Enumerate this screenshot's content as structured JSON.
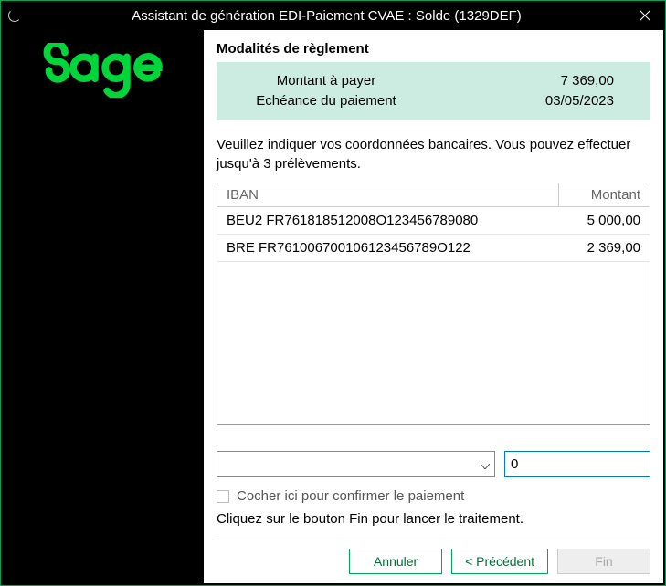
{
  "titlebar": {
    "title": "Assistant de génération EDI-Paiement CVAE : Solde (1329DEF)"
  },
  "section": {
    "title": "Modalités de règlement"
  },
  "summary": {
    "montant_label": "Montant à payer",
    "montant_value": "7 369,00",
    "echeance_label": "Echéance du paiement",
    "echeance_value": "03/05/2023"
  },
  "instructions": "Veuillez indiquer vos coordonnées bancaires. Vous pouvez effectuer jusqu'à 3 prélèvements.",
  "table": {
    "headers": {
      "iban": "IBAN",
      "montant": "Montant"
    },
    "rows": [
      {
        "iban": "BEU2 FR761818512008O123456789080",
        "montant": "5 000,00"
      },
      {
        "iban": "BRE FR761006700106123456789O122",
        "montant": "2 369,00"
      }
    ]
  },
  "form": {
    "combo_value": "",
    "amount_value": "0"
  },
  "checkbox": {
    "label": "Cocher ici pour confirmer le paiement"
  },
  "final_instruction": "Cliquez sur le bouton Fin pour lancer le traitement.",
  "buttons": {
    "cancel": "Annuler",
    "prev": "< Précédent",
    "finish": "Fin"
  }
}
